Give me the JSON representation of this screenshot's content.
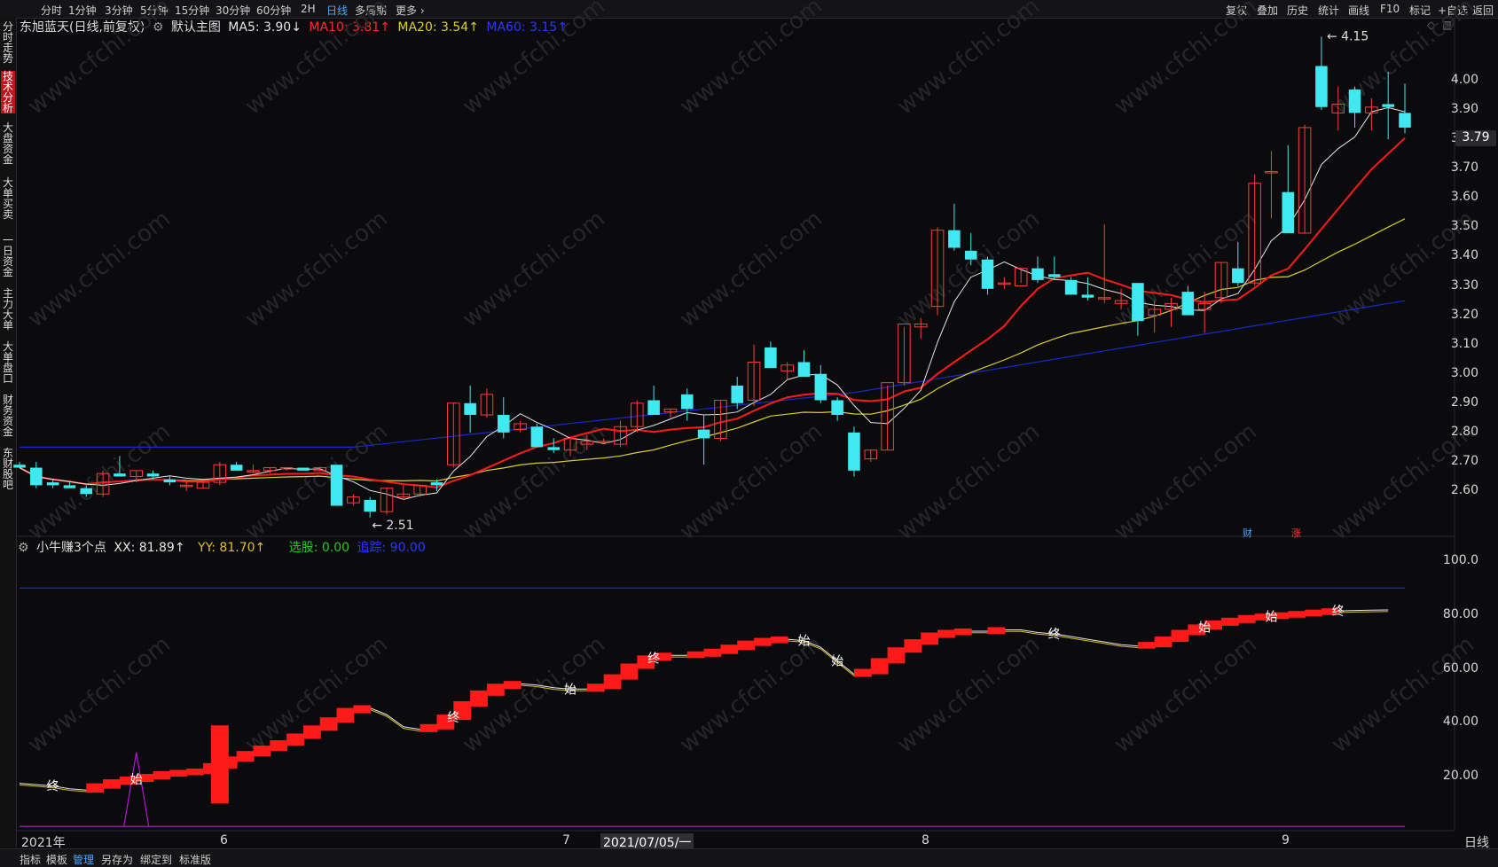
{
  "topbar": {
    "periods": [
      "分时",
      "1分钟",
      "3分钟",
      "5分钟",
      "15分钟",
      "30分钟",
      "60分钟",
      "2H",
      "日线",
      "多周期",
      "更多"
    ],
    "active_period": "日线",
    "tools": [
      "复权",
      "叠加",
      "历史",
      "统计",
      "画线",
      "F10",
      "标记",
      "+自选",
      "返回"
    ]
  },
  "leftnav": [
    "分时走势",
    "技术分析",
    "大盘资金",
    "大单买卖",
    "一日资金",
    "主力大单",
    "大单盘口",
    "财务资金",
    "东财股吧"
  ],
  "leftnav_active": "技术分析",
  "main": {
    "stock_name": "东旭蓝天(日线,前复权)",
    "template": "默认主图",
    "ma5": "MA5: 3.90↓",
    "ma10": "MA10: 3.81↑",
    "ma20": "MA20: 3.54↑",
    "ma60": "MA60: 3.15↑",
    "price_axis": [
      "4.00",
      "3.90",
      "3.80",
      "3.70",
      "3.60",
      "3.50",
      "3.40",
      "3.30",
      "3.20",
      "3.10",
      "3.00",
      "2.90",
      "2.80",
      "2.70",
      "2.60"
    ],
    "last_price": "3.79",
    "high_marker": "4.15",
    "low_marker": "2.51",
    "badges": [
      "财",
      "涨"
    ],
    "colors": {
      "up": "#ff3b3b",
      "down": "#40e8f0",
      "ma5": "#e6e6e6",
      "ma10": "#ff1a1a",
      "ma20": "#d8cf2c",
      "ma60": "#1c28c8"
    }
  },
  "indicator": {
    "name": "小牛赚3个点",
    "xx": "XX: 81.89↑",
    "yy": "YY: 81.70↑",
    "select": "选股: 0.00",
    "ref": "追踪: 90.00",
    "axis": [
      "100.0",
      "80.00",
      "60.00",
      "40.00",
      "20.00"
    ],
    "start_label": "始",
    "end_label": "终"
  },
  "xaxis": {
    "labels": [
      "2021年",
      "6",
      "7",
      "2021/07/05/一",
      "8",
      "9"
    ],
    "period": "日线"
  },
  "bottombar": [
    "指标",
    "模板",
    "管理",
    "另存为",
    "绑定到",
    "标准版"
  ],
  "bottombar_active": "管理",
  "watermark": "www.cfchi.com",
  "chart_data": {
    "type": "candlestick",
    "candles": [
      [
        2.69,
        2.7,
        2.68,
        2.68
      ],
      [
        2.68,
        2.7,
        2.61,
        2.62
      ],
      [
        2.63,
        2.64,
        2.61,
        2.62
      ],
      [
        2.62,
        2.63,
        2.61,
        2.61
      ],
      [
        2.61,
        2.62,
        2.58,
        2.59
      ],
      [
        2.59,
        2.67,
        2.58,
        2.66
      ],
      [
        2.66,
        2.72,
        2.65,
        2.65
      ],
      [
        2.65,
        2.67,
        2.63,
        2.67
      ],
      [
        2.66,
        2.67,
        2.64,
        2.65
      ],
      [
        2.64,
        2.65,
        2.62,
        2.63
      ],
      [
        2.62,
        2.64,
        2.6,
        2.62
      ],
      [
        2.61,
        2.63,
        2.61,
        2.63
      ],
      [
        2.63,
        2.7,
        2.62,
        2.69
      ],
      [
        2.69,
        2.7,
        2.67,
        2.67
      ],
      [
        2.67,
        2.69,
        2.66,
        2.67
      ],
      [
        2.67,
        2.68,
        2.66,
        2.68
      ],
      [
        2.68,
        2.68,
        2.67,
        2.68
      ],
      [
        2.68,
        2.68,
        2.67,
        2.67
      ],
      [
        2.67,
        2.68,
        2.67,
        2.68
      ],
      [
        2.69,
        2.69,
        2.55,
        2.55
      ],
      [
        2.56,
        2.59,
        2.55,
        2.58
      ],
      [
        2.57,
        2.58,
        2.51,
        2.53
      ],
      [
        2.53,
        2.61,
        2.52,
        2.61
      ],
      [
        2.58,
        2.62,
        2.57,
        2.59
      ],
      [
        2.59,
        2.62,
        2.58,
        2.62
      ],
      [
        2.63,
        2.64,
        2.6,
        2.62
      ],
      [
        2.69,
        2.9,
        2.68,
        2.9
      ],
      [
        2.9,
        2.96,
        2.8,
        2.86
      ],
      [
        2.86,
        2.95,
        2.85,
        2.93
      ],
      [
        2.86,
        2.92,
        2.78,
        2.8
      ],
      [
        2.81,
        2.84,
        2.8,
        2.83
      ],
      [
        2.82,
        2.83,
        2.75,
        2.75
      ],
      [
        2.75,
        2.78,
        2.73,
        2.74
      ],
      [
        2.74,
        2.78,
        2.72,
        2.78
      ],
      [
        2.76,
        2.79,
        2.74,
        2.77
      ],
      [
        2.77,
        2.78,
        2.76,
        2.77
      ],
      [
        2.76,
        2.84,
        2.75,
        2.82
      ],
      [
        2.82,
        2.91,
        2.8,
        2.9
      ],
      [
        2.91,
        2.96,
        2.86,
        2.86
      ],
      [
        2.87,
        2.88,
        2.85,
        2.88
      ],
      [
        2.93,
        2.95,
        2.84,
        2.88
      ],
      [
        2.81,
        2.86,
        2.69,
        2.78
      ],
      [
        2.78,
        2.91,
        2.77,
        2.91
      ],
      [
        2.96,
        2.99,
        2.88,
        2.9
      ],
      [
        2.91,
        3.1,
        2.89,
        3.04
      ],
      [
        3.09,
        3.11,
        3.02,
        3.02
      ],
      [
        3.01,
        3.04,
        2.98,
        3.03
      ],
      [
        3.04,
        3.08,
        3.01,
        2.99
      ],
      [
        3.0,
        3.03,
        2.9,
        2.91
      ],
      [
        2.91,
        2.92,
        2.84,
        2.86
      ],
      [
        2.8,
        2.82,
        2.65,
        2.67
      ],
      [
        2.71,
        2.74,
        2.7,
        2.74
      ],
      [
        2.74,
        2.96,
        2.74,
        2.97
      ],
      [
        2.97,
        3.16,
        2.96,
        3.17
      ],
      [
        3.16,
        3.19,
        3.12,
        3.17
      ],
      [
        3.23,
        3.5,
        3.2,
        3.49
      ],
      [
        3.49,
        3.58,
        3.42,
        3.43
      ],
      [
        3.42,
        3.48,
        3.37,
        3.39
      ],
      [
        3.39,
        3.4,
        3.27,
        3.29
      ],
      [
        3.31,
        3.33,
        3.29,
        3.31
      ],
      [
        3.3,
        3.36,
        3.31,
        3.36
      ],
      [
        3.36,
        3.4,
        3.31,
        3.32
      ],
      [
        3.34,
        3.4,
        3.32,
        3.33
      ],
      [
        3.32,
        3.33,
        3.28,
        3.27
      ],
      [
        3.27,
        3.33,
        3.25,
        3.26
      ],
      [
        3.26,
        3.51,
        3.24,
        3.26
      ],
      [
        3.24,
        3.29,
        3.22,
        3.25
      ],
      [
        3.31,
        3.31,
        3.13,
        3.18
      ],
      [
        3.2,
        3.25,
        3.14,
        3.22
      ],
      [
        3.22,
        3.26,
        3.16,
        3.24
      ],
      [
        3.28,
        3.3,
        3.2,
        3.2
      ],
      [
        3.22,
        3.28,
        3.14,
        3.24
      ],
      [
        3.26,
        3.38,
        3.24,
        3.38
      ],
      [
        3.36,
        3.45,
        3.3,
        3.31
      ],
      [
        3.31,
        3.68,
        3.3,
        3.65
      ],
      [
        3.69,
        3.76,
        3.53,
        3.69
      ],
      [
        3.62,
        3.78,
        3.48,
        3.48
      ],
      [
        3.48,
        3.85,
        3.48,
        3.84
      ],
      [
        4.05,
        4.15,
        3.9,
        3.91
      ],
      [
        3.89,
        3.98,
        3.83,
        3.92
      ],
      [
        3.97,
        3.98,
        3.84,
        3.89
      ],
      [
        3.89,
        3.94,
        3.83,
        3.91
      ],
      [
        3.92,
        4.03,
        3.8,
        3.91
      ],
      [
        3.89,
        3.99,
        3.82,
        3.84
      ]
    ],
    "ylim": [
      2.48,
      4.18
    ],
    "indicator_series": {
      "xx": [
        17.5,
        17.0,
        16.5,
        15.5,
        15.0,
        16.5,
        18.0,
        19.0,
        20.0,
        21.0,
        21.5,
        22.0,
        24.0,
        26.5,
        28.5,
        30.5,
        32.5,
        35.0,
        38.0,
        41.0,
        44.5,
        45.5,
        43.0,
        38.5,
        37.5,
        38.5,
        42.0,
        47.0,
        51.0,
        53.5,
        54.5,
        54.0,
        53.0,
        52.5,
        52.5,
        53.5,
        57.0,
        61.0,
        64.0,
        65.0,
        65.0,
        65.5,
        66.5,
        68.0,
        69.5,
        70.5,
        71.0,
        70.5,
        68.0,
        63.0,
        58.0,
        59.0,
        63.0,
        67.0,
        70.0,
        72.5,
        73.5,
        74.0,
        74.0,
        74.5,
        74.5,
        73.5,
        73.0,
        72.0,
        71.0,
        70.0,
        69.0,
        68.5,
        69.0,
        71.0,
        73.5,
        75.5,
        77.0,
        78.0,
        79.0,
        79.5,
        80.0,
        80.5,
        81.0,
        81.5,
        81.7,
        81.8,
        81.9
      ],
      "ref": 90.0,
      "spike_index": 7,
      "spike_value": 29,
      "bar_index": 12,
      "bar_range": [
        10,
        39
      ]
    }
  }
}
